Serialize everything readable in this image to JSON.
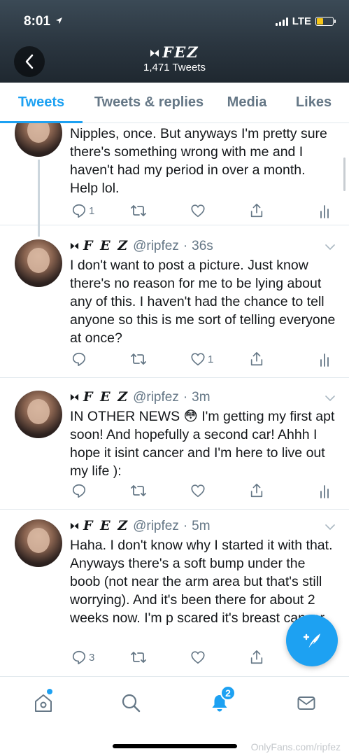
{
  "status_bar": {
    "time": "8:01",
    "network": "LTE"
  },
  "header": {
    "title": "FEZ",
    "tweet_count": "1,471 Tweets"
  },
  "tabs": [
    {
      "label": "Tweets",
      "active": true
    },
    {
      "label": "Tweets & replies",
      "active": false
    },
    {
      "label": "Media",
      "active": false
    },
    {
      "label": "Likes",
      "active": false
    }
  ],
  "tweets": [
    {
      "name": "",
      "handle": "",
      "time": "",
      "text": "Nipples, once. But anyways I'm pretty sure there's something wrong with me and I haven't had my period in over a month. Help lol.",
      "reply_count": "1",
      "like_count": ""
    },
    {
      "name": "F E Z",
      "handle": "@ripfez",
      "time": "36s",
      "text": "I don't want to post a picture. Just know there's no reason for me to be lying about any of this. I haven't had the chance to tell anyone so this is me sort of telling everyone at once?",
      "reply_count": "",
      "like_count": "1"
    },
    {
      "name": "F E Z",
      "handle": "@ripfez",
      "time": "3m",
      "text": "IN OTHER NEWS 😳 I'm getting my first apt soon! And hopefully a second car! Ahhh I hope it isint cancer and I'm here to live out my life ):",
      "reply_count": "",
      "like_count": ""
    },
    {
      "name": "F E Z",
      "handle": "@ripfez",
      "time": "5m",
      "text": "Haha. I don't know why I started it with that. Anyways there's a soft bump under the boob (not near the arm area but that's still worrying). And it's been there for about 2 weeks now. I'm p scared it's breast cancer",
      "reply_count": "3",
      "like_count": ""
    }
  ],
  "bottom_nav": {
    "notifications_badge": "2"
  },
  "watermark": "OnlyFans.com/ripfez",
  "colors": {
    "accent": "#1da1f2",
    "muted": "#657786",
    "divider": "#e1e8ed"
  }
}
